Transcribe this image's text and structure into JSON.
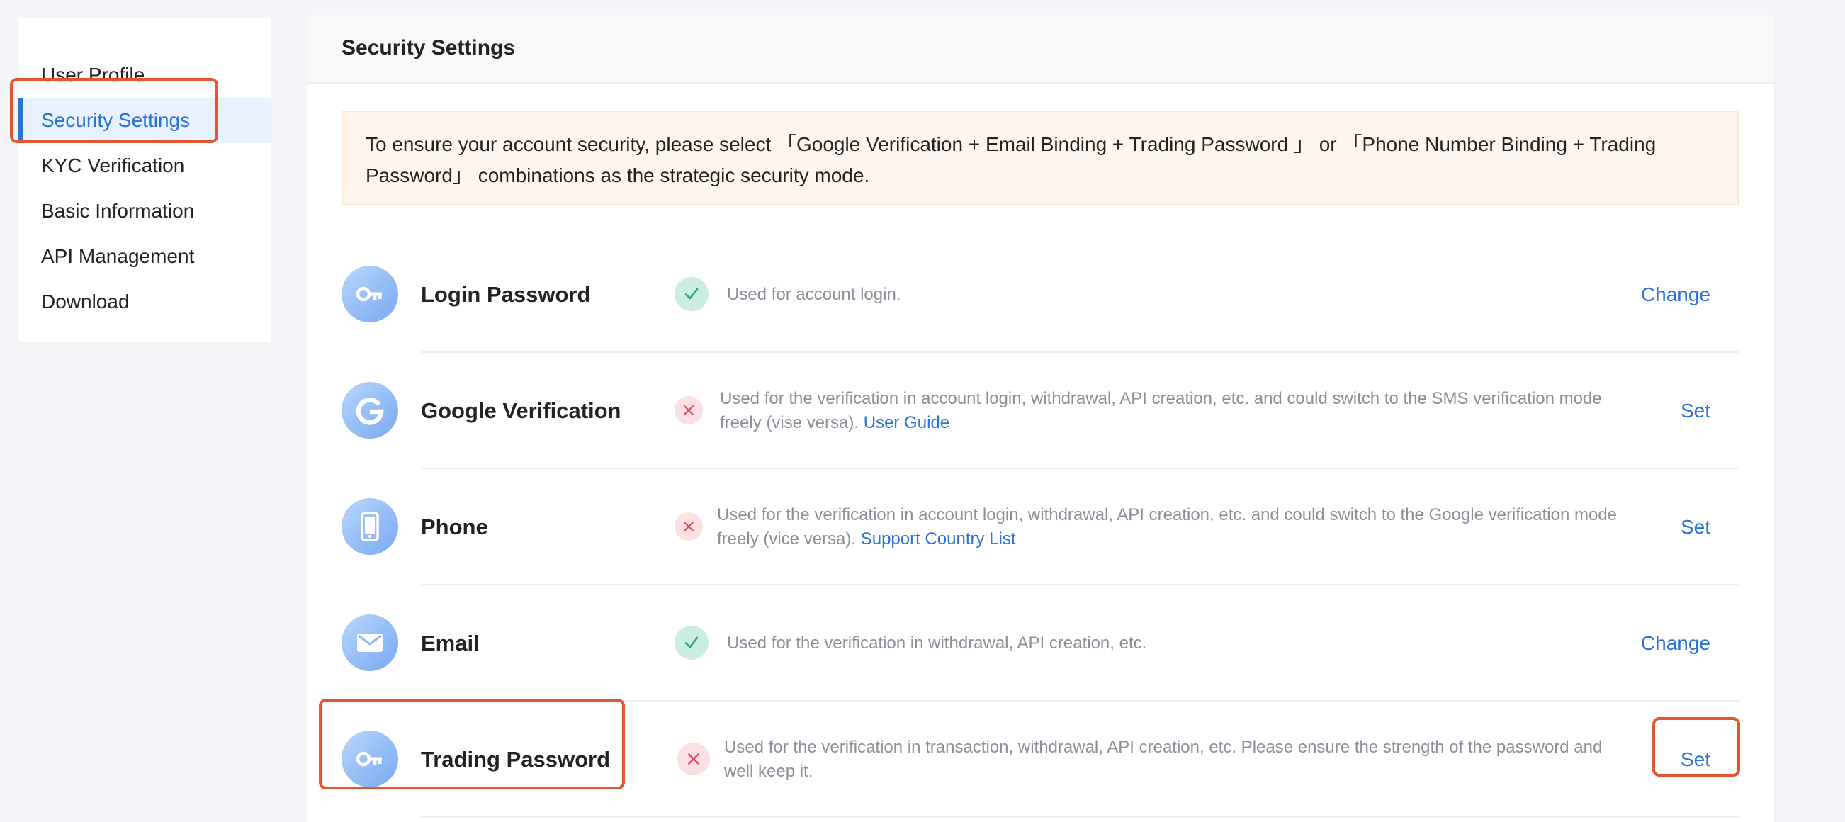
{
  "sidebar": {
    "items": [
      {
        "label": "User Profile",
        "active": false
      },
      {
        "label": "Security Settings",
        "active": true
      },
      {
        "label": "KYC Verification",
        "active": false
      },
      {
        "label": "Basic Information",
        "active": false
      },
      {
        "label": "API Management",
        "active": false
      },
      {
        "label": "Download",
        "active": false
      }
    ]
  },
  "main": {
    "title": "Security Settings",
    "notice": "To ensure your account security, please select 「Google Verification + Email Binding + Trading Password 」 or 「Phone Number Binding + Trading Password」 combinations as the strategic security mode.",
    "rows": [
      {
        "title": "Login Password",
        "icon": "key-icon",
        "status": "set",
        "status_icon": "check-icon",
        "description": "Used for account login.",
        "link": "",
        "action": "Change"
      },
      {
        "title": "Google Verification",
        "icon": "google-icon",
        "status": "unset",
        "status_icon": "cross-icon",
        "description": "Used for the verification in account login, withdrawal, API creation, etc. and could switch to the SMS verification mode freely (vise versa).",
        "link": "User Guide",
        "action": "Set"
      },
      {
        "title": "Phone",
        "icon": "phone-icon",
        "status": "unset",
        "status_icon": "cross-icon",
        "description": "Used for the verification in account login, withdrawal, API creation, etc. and could switch to the Google verification mode freely (vice versa).",
        "link": "Support Country List",
        "action": "Set"
      },
      {
        "title": "Email",
        "icon": "mail-icon",
        "status": "set",
        "status_icon": "check-icon",
        "description": "Used for the verification in withdrawal, API creation, etc.",
        "link": "",
        "action": "Change"
      },
      {
        "title": "Trading Password",
        "icon": "key-icon",
        "status": "unset",
        "status_icon": "cross-icon",
        "description": "Used for the verification in transaction, withdrawal, API creation, etc. Please ensure the strength of the password and well keep it.",
        "link": "",
        "action": "Set"
      }
    ]
  },
  "colors": {
    "accent": "#2a72d6",
    "callout": "#e2552d",
    "success": "#2aa67a",
    "danger": "#e24a5d"
  }
}
